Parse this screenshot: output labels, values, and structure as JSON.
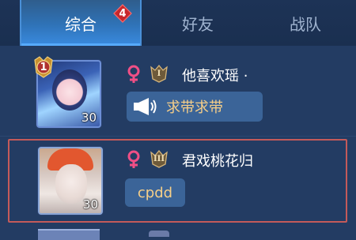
{
  "tabs": [
    {
      "label": "综合",
      "active": true
    },
    {
      "label": "好友",
      "active": false
    },
    {
      "label": "战队",
      "active": false
    }
  ],
  "tab_badge": "4",
  "rows": [
    {
      "rank_number": "1",
      "level": "30",
      "gender_icon": "female-icon",
      "tier_label": "I",
      "name": "他喜欢瑶 ·",
      "message": "求带求带",
      "message_icon": "megaphone-icon"
    },
    {
      "level": "30",
      "gender_icon": "female-icon",
      "tier_label": "III",
      "name": "君戏桃花归",
      "message": "cpdd"
    }
  ],
  "colors": {
    "background": "#233c63",
    "active_tab": "#2f73b8",
    "female": "#f04f86",
    "message_text": "#f7cf88",
    "highlight_border": "#c45a5a"
  }
}
